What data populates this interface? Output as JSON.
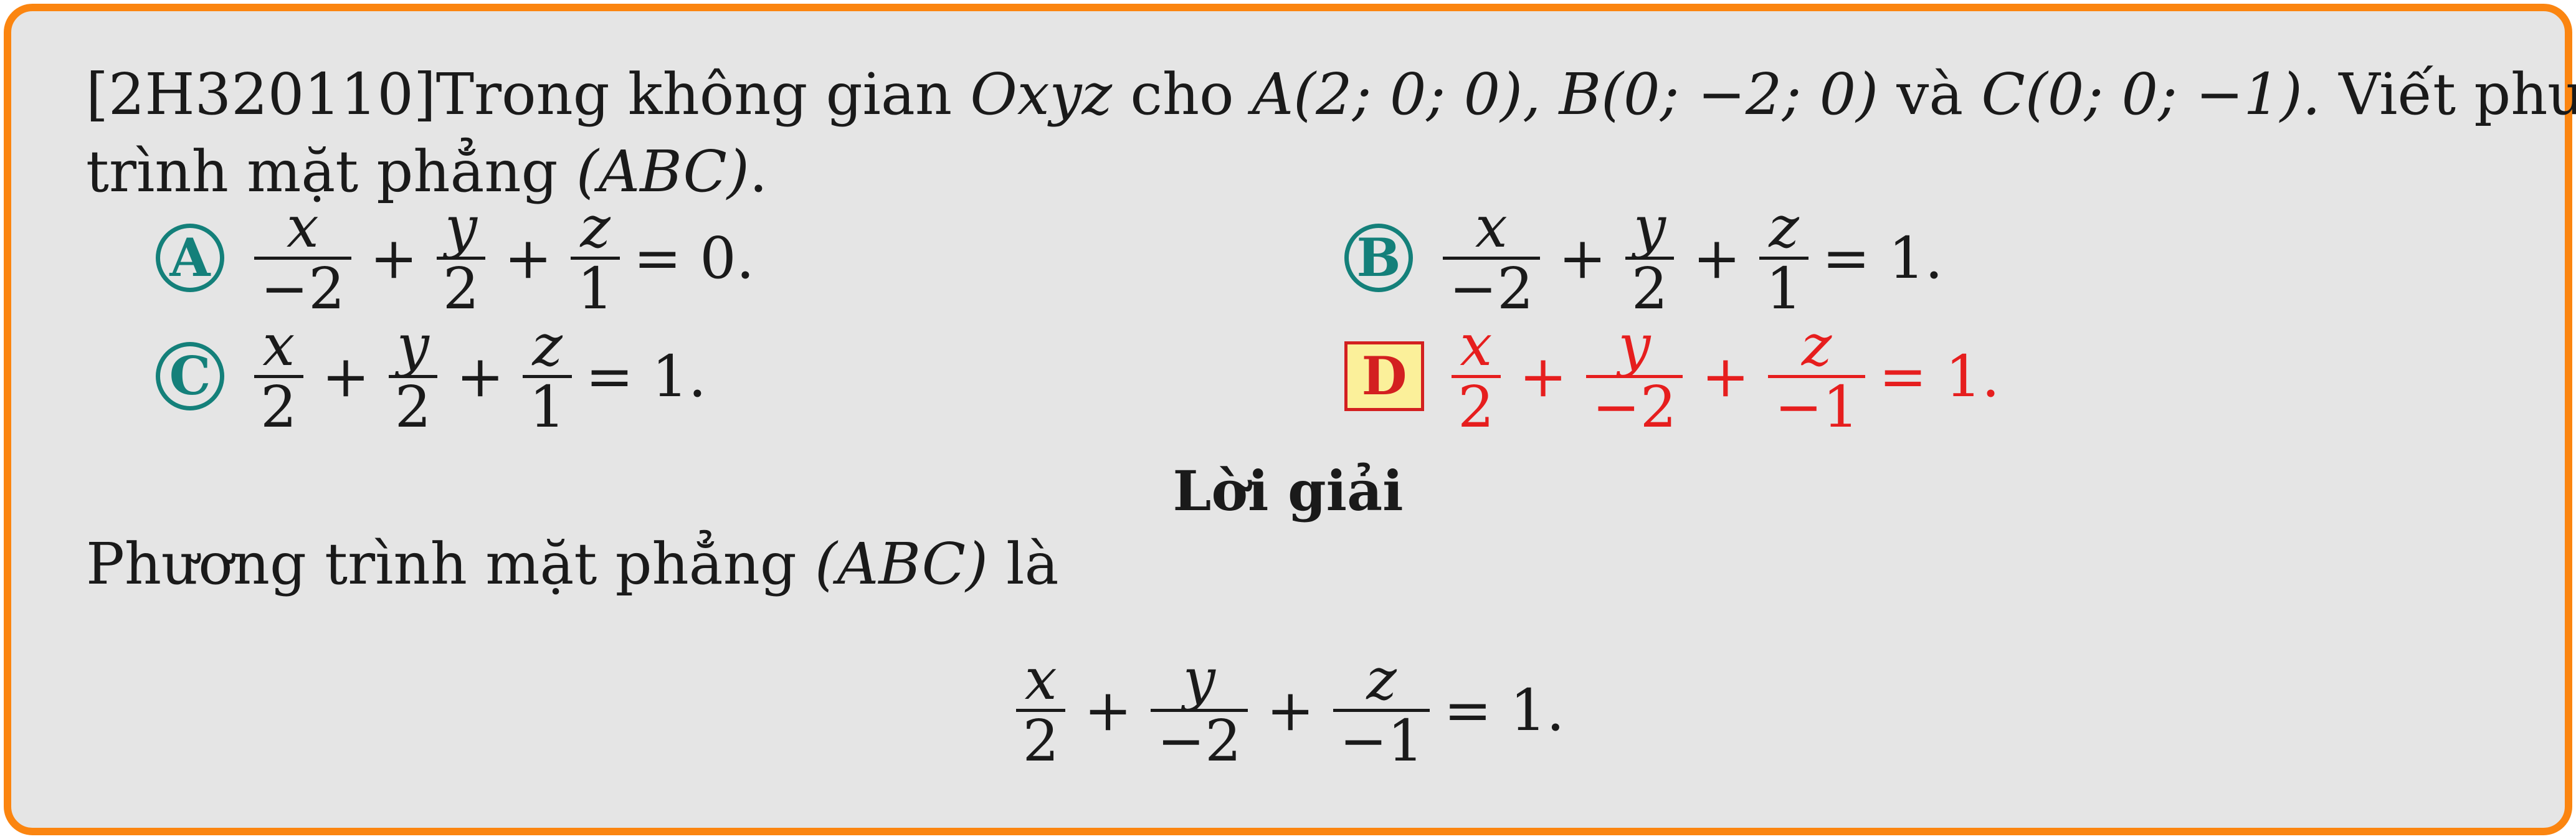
{
  "question": {
    "code": "[2H320110]",
    "line1_intro": "Trong không gian ",
    "space_name": "Oxyz",
    "line1_mid": " cho ",
    "point_A": "A(2; 0; 0),",
    "point_B": "B(0; −2; 0)",
    "and_word": " và ",
    "point_C": "C(0; 0; −1).",
    "line1_end": " Viết phương",
    "line2": "trình mặt phẳng ",
    "plane": "(ABC)",
    "line2_end": "."
  },
  "options": {
    "A": {
      "label": "A",
      "fracs": [
        [
          "x",
          "−2"
        ],
        [
          "y",
          "2"
        ],
        [
          "z",
          "1"
        ]
      ],
      "ops": [
        "+",
        "+"
      ],
      "rhs": "= 0."
    },
    "B": {
      "label": "B",
      "fracs": [
        [
          "x",
          "−2"
        ],
        [
          "y",
          "2"
        ],
        [
          "z",
          "1"
        ]
      ],
      "ops": [
        "+",
        "+"
      ],
      "rhs": "= 1."
    },
    "C": {
      "label": "C",
      "fracs": [
        [
          "x",
          "2"
        ],
        [
          "y",
          "2"
        ],
        [
          "z",
          "1"
        ]
      ],
      "ops": [
        "+",
        "+"
      ],
      "rhs": "= 1."
    },
    "D": {
      "label": "D",
      "fracs": [
        [
          "x",
          "2"
        ],
        [
          "y",
          "−2"
        ],
        [
          "z",
          "−1"
        ]
      ],
      "ops": [
        "+",
        "+"
      ],
      "rhs": "= 1."
    }
  },
  "correct_option": "D",
  "colors": {
    "border": "#fb8510",
    "background": "#e5e5e5",
    "label": "#14807a",
    "correct": "#e61e1e",
    "correct_bg": "#fbf09a"
  },
  "solution": {
    "title": "Lời giải",
    "text": "Phương trình mặt phẳng ",
    "plane": "(ABC)",
    "text_end": " là",
    "equation": {
      "fracs": [
        [
          "x",
          "2"
        ],
        [
          "y",
          "−2"
        ],
        [
          "z",
          "−1"
        ]
      ],
      "ops": [
        "+",
        "+"
      ],
      "rhs": "= 1."
    }
  }
}
